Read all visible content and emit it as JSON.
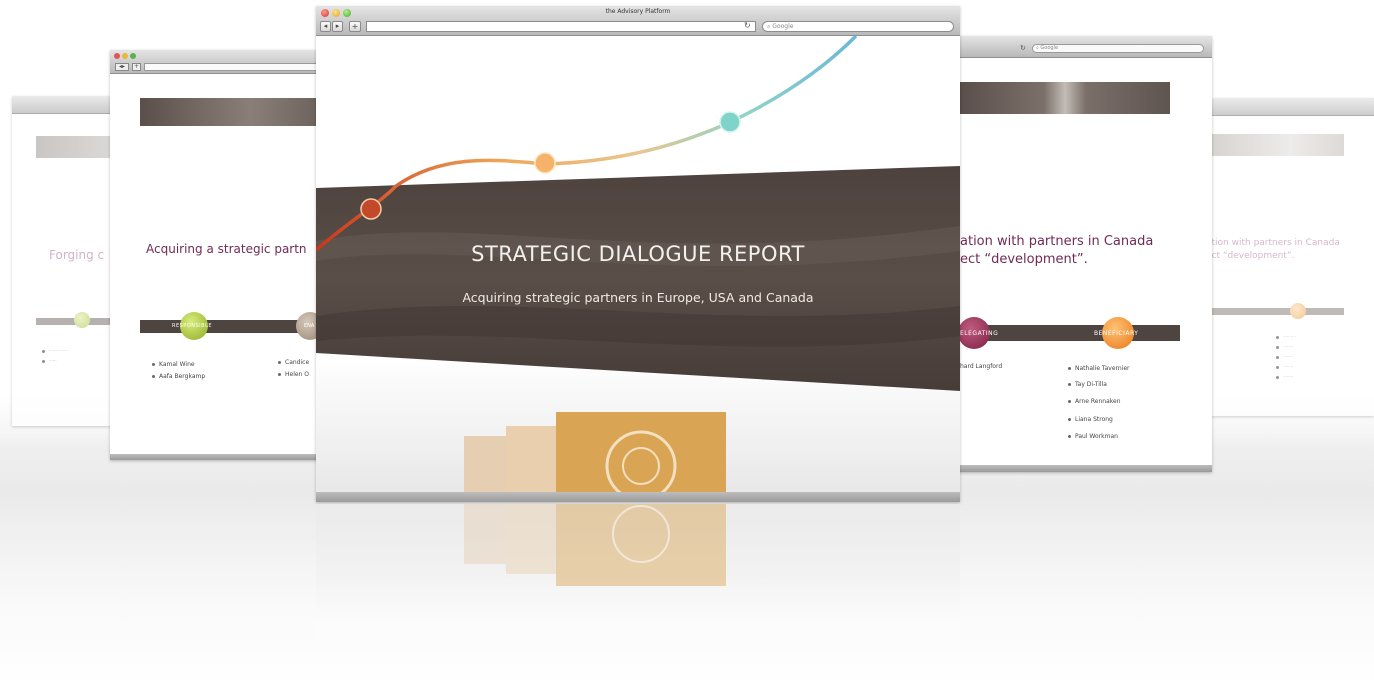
{
  "main_window": {
    "title": "the Advisory Platform",
    "search_placeholder": "Google",
    "hero_title": "STRATEGIC DIALOGUE REPORT",
    "hero_subtitle": "Acquiring strategic partners in Europe, USA and Canada"
  },
  "left_window": {
    "heading": "Acquiring a strategic partn",
    "band_labels": [
      "RESPONSIBLE",
      "ENA"
    ],
    "list_col1": [
      "Kamal Wine",
      "Aafa Bergkamp"
    ],
    "list_col2": [
      "Candice",
      "Helen O"
    ]
  },
  "far_left_window": {
    "heading": "Forging c"
  },
  "right_window": {
    "search_placeholder": "Google",
    "heading_line1": "ation with partners in Canada",
    "heading_line2": "ect “development”.",
    "band_labels": [
      "ELEGATING",
      "BENEFICIARY"
    ],
    "list_left": [
      "hard Langford"
    ],
    "list_right": [
      "Nathalie Tavernier",
      "Tay Di-Tilla",
      "Arne Rennaken",
      "Liana Strong",
      "Paul Workman"
    ]
  },
  "far_right_window": {
    "heading_line1": "ation with partners in Canada",
    "heading_line2": "ect “development”."
  },
  "colors": {
    "accent_purple": "#6f2b55",
    "band_dark": "#4e4440",
    "ball_red": "#c24a2a",
    "ball_orange": "#f0a050",
    "ball_teal": "#6ccbc4",
    "ball_green": "#9bbb30"
  }
}
